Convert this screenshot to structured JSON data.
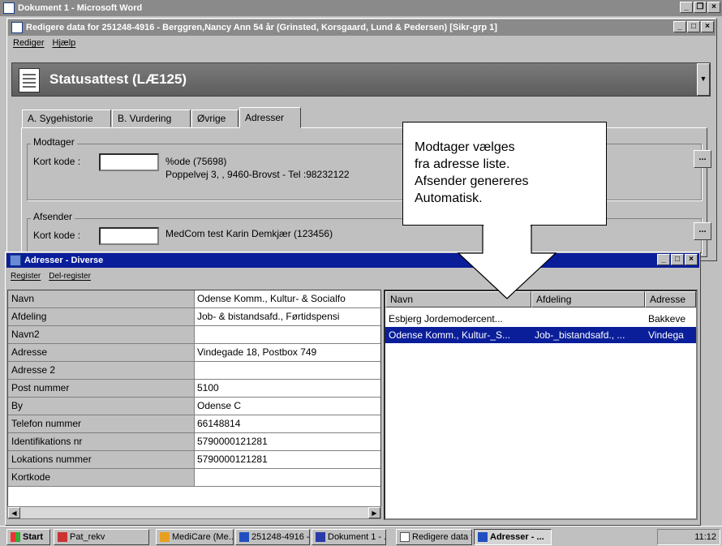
{
  "word": {
    "title": "Dokument 1 - Microsoft Word"
  },
  "editwin": {
    "title": "Redigere data for 251248-4916 - Berggren,Nancy Ann  54 år  (Grinsted, Korsgaard, Lund & Pedersen)  [Sikr-grp 1]",
    "menu": [
      "Rediger",
      "Hjælp"
    ]
  },
  "status": {
    "title": "Statusattest (LÆ125)"
  },
  "tabs": [
    "A. Sygehistorie",
    "B. Vurdering",
    "Øvrige",
    "Adresser"
  ],
  "modtager": {
    "label": "Modtager",
    "kort_label": "Kort kode :",
    "line1": "%ode  (75698)",
    "line2": "Poppelvej 3, , 9460-Brovst - Tel :98232122",
    "button": "..."
  },
  "afsender": {
    "label": "Afsender",
    "kort_label": "Kort kode :",
    "line1": "MedCom test  Karin Demkjær (123456)",
    "button": "..."
  },
  "callout": {
    "lines": [
      "Modtager vælges",
      "fra adresse liste.",
      "Afsender genereres",
      "Automatisk."
    ]
  },
  "adresser": {
    "title": "Adresser - Diverse",
    "menu": [
      "Register",
      "Del-register"
    ],
    "fields": [
      {
        "label": "Navn",
        "value": "Odense Komm., Kultur- & Socialfo"
      },
      {
        "label": "Afdeling",
        "value": "Job- & bistandsafd., Førtidspensi"
      },
      {
        "label": "Navn2",
        "value": ""
      },
      {
        "label": "Adresse",
        "value": "Vindegade 18, Postbox 749"
      },
      {
        "label": "Adresse 2",
        "value": ""
      },
      {
        "label": "Post nummer",
        "value": "5100"
      },
      {
        "label": "By",
        "value": "Odense C"
      },
      {
        "label": "Telefon nummer",
        "value": "66148814"
      },
      {
        "label": "Identifikations nr",
        "value": "5790000121281"
      },
      {
        "label": "Lokations nummer",
        "value": "5790000121281"
      },
      {
        "label": "Kortkode",
        "value": ""
      }
    ],
    "list_headers": [
      "Navn",
      "Afdeling",
      "Adresse"
    ],
    "list_rows": [
      {
        "navn": "Esbjerg Jordemodercent...",
        "afdeling": "",
        "adresse": "Bakkeve"
      },
      {
        "navn": "Odense Komm., Kultur-_S...",
        "afdeling": "Job-_bistandsafd., ...",
        "adresse": "Vindega"
      }
    ]
  },
  "taskbar": {
    "start": "Start",
    "items": [
      "Pat_rekv",
      "MediCare (Me...",
      "251248-4916 - ...",
      "Dokument 1 - ...",
      "Redigere data f...",
      "Adresser - ..."
    ],
    "clock": "11:12"
  },
  "colors": {
    "titlebar_active": "#0a1e9a",
    "titlebar_inactive": "#808080",
    "selection": "#0a1e9a"
  }
}
